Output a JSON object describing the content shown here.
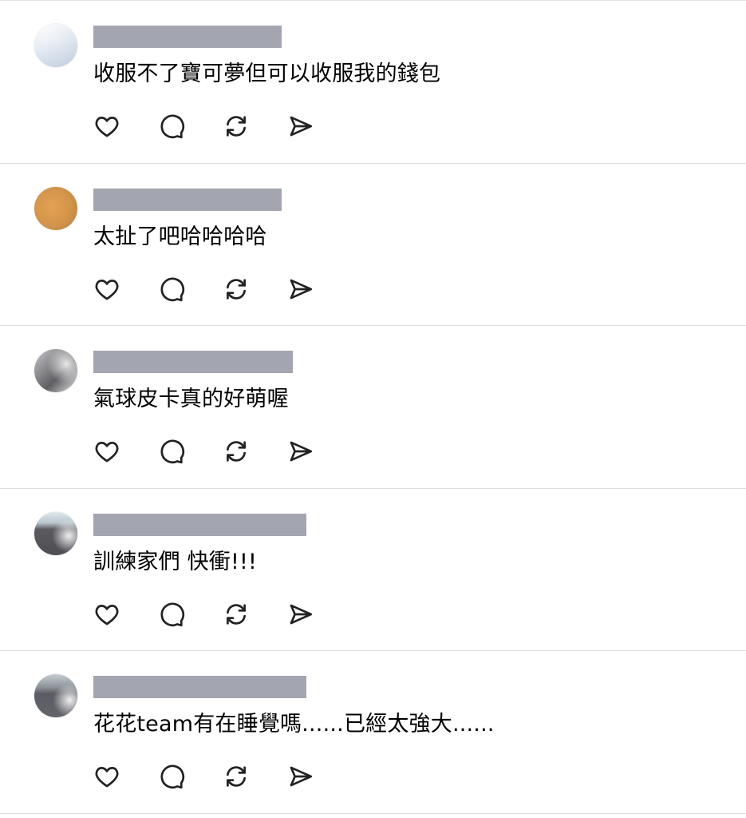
{
  "posts": [
    {
      "text": "收服不了寶可夢但可以收服我的錢包",
      "avatar_color": "#dfe6f0"
    },
    {
      "text": "太扯了吧哈哈哈哈",
      "avatar_color": "#d99a4e"
    },
    {
      "text": "氣球皮卡真的好萌喔",
      "avatar_color": "#6c6c70"
    },
    {
      "text": "訓練家們 快衝!!!",
      "avatar_color": "#59595e"
    },
    {
      "text": "花花team有在睡覺嗎......已經太強大......",
      "avatar_color": "#5f6068"
    }
  ],
  "actions": [
    {
      "name": "like",
      "icon": "heart-icon"
    },
    {
      "name": "comment",
      "icon": "speech-bubble-icon"
    },
    {
      "name": "repost",
      "icon": "repost-icon"
    },
    {
      "name": "share",
      "icon": "send-icon"
    }
  ],
  "colors": {
    "redaction_bar": "#a3a6b1",
    "divider": "#dcdcdc",
    "icon_stroke": "#222222"
  }
}
